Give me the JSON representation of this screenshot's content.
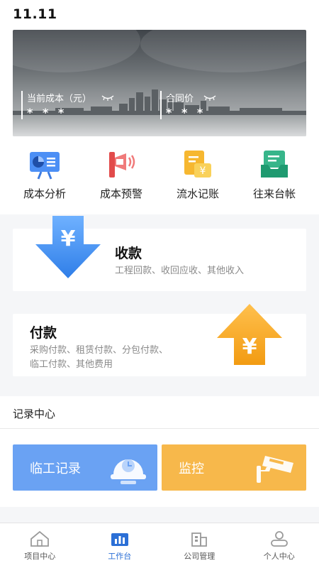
{
  "status_bar": {
    "time": "11.11"
  },
  "banner": {
    "stat_cost": {
      "label": "当前成本（元）",
      "value": "* * *"
    },
    "stat_contract": {
      "label": "合同价",
      "value": "* * *"
    }
  },
  "shortcuts": [
    {
      "label": "成本分析",
      "icon": "chart-board-icon"
    },
    {
      "label": "成本预警",
      "icon": "megaphone-icon"
    },
    {
      "label": "流水记账",
      "icon": "yen-document-icon"
    },
    {
      "label": "往来台帐",
      "icon": "inbox-icon"
    }
  ],
  "receive_card": {
    "title": "收款",
    "desc": "工程回款、收回应收、其他收入",
    "arrow_symbol": "¥"
  },
  "pay_card": {
    "title": "付款",
    "desc_line1": "采购付款、租赁付款、分包付款、",
    "desc_line2": "临工付款、其他费用",
    "arrow_symbol": "¥"
  },
  "records": {
    "heading": "记录中心",
    "temp_worker": "临工记录",
    "monitor": "监控"
  },
  "tabs": [
    {
      "label": "项目中心",
      "active": false
    },
    {
      "label": "工作台",
      "active": true
    },
    {
      "label": "公司管理",
      "active": false
    },
    {
      "label": "个人中心",
      "active": false
    }
  ],
  "colors": {
    "accent_blue": "#2b6fd6",
    "tile_blue": "#6aa2f3",
    "tile_yellow": "#f7b84b",
    "arrow_blue": "#3f8ef2",
    "arrow_orange": "#f5a623"
  }
}
